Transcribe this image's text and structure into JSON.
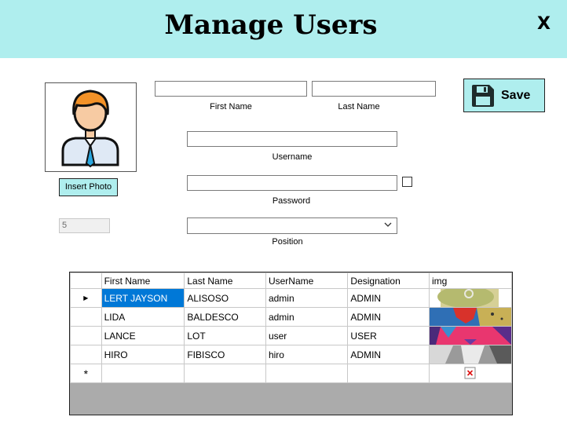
{
  "header": {
    "title": "Manage Users",
    "close_label": "X"
  },
  "photo": {
    "insert_label": "Insert Photo"
  },
  "form": {
    "id_value": "5",
    "first_name_label": "First Name",
    "last_name_label": "Last Name",
    "username_label": "Username",
    "password_label": "Password",
    "position_label": "Position",
    "first_name_value": "",
    "last_name_value": "",
    "username_value": "",
    "password_value": "",
    "position_value": ""
  },
  "save_label": "Save",
  "grid": {
    "columns": [
      "First Name",
      "Last Name",
      "UserName",
      "Designation",
      "img"
    ],
    "rows": [
      {
        "first": "LERT JAYSON",
        "last": "ALISOSO",
        "user": "admin",
        "designation": "ADMIN"
      },
      {
        "first": "LIDA",
        "last": "BALDESCO",
        "user": "admin",
        "designation": "ADMIN"
      },
      {
        "first": "LANCE",
        "last": "LOT",
        "user": "user",
        "designation": "USER"
      },
      {
        "first": "HIRO",
        "last": "FIBISCO",
        "user": "hiro",
        "designation": "ADMIN"
      }
    ],
    "new_row_marker": "*",
    "current_row_marker": "▶"
  },
  "colors": {
    "accent": "#afeeee",
    "selection": "#0078d7",
    "grid_empty": "#ababab"
  }
}
